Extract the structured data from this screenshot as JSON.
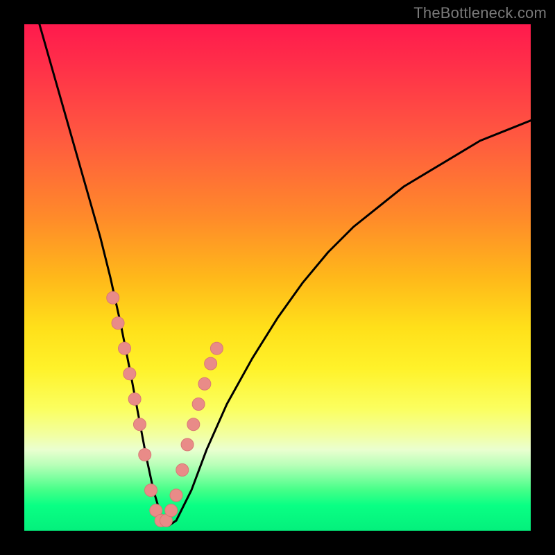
{
  "watermark": "TheBottleneck.com",
  "colors": {
    "curve": "#000000",
    "marker_fill": "#e98b88",
    "marker_stroke": "#d87975",
    "frame": "#000000"
  },
  "chart_data": {
    "type": "line",
    "title": "",
    "xlabel": "",
    "ylabel": "",
    "xlim": [
      0,
      100
    ],
    "ylim": [
      0,
      100
    ],
    "grid": false,
    "note": "Axes have no visible tick labels. Curve values are estimated from pixel positions: x is 0–100 left→right, y is 0–100 with 0 at bottom, 100 at top (bottleneck % style).",
    "series": [
      {
        "name": "bottleneck-curve",
        "x": [
          3,
          5,
          7,
          9,
          11,
          13,
          15,
          17,
          19,
          21,
          22.5,
          24,
          25.5,
          27,
          28.5,
          30,
          33,
          36,
          40,
          45,
          50,
          55,
          60,
          65,
          70,
          75,
          80,
          85,
          90,
          95,
          100
        ],
        "y": [
          100,
          93,
          86,
          79,
          72,
          65,
          58,
          50,
          41,
          31,
          23,
          15,
          8,
          3,
          1,
          2,
          8,
          16,
          25,
          34,
          42,
          49,
          55,
          60,
          64,
          68,
          71,
          74,
          77,
          79,
          81
        ]
      }
    ],
    "markers": {
      "name": "highlighted-points",
      "note": "Pink dots emphasizing the near-bottom region of the V-curve (both flanks) plus the trough.",
      "x": [
        17.5,
        18.5,
        19.8,
        20.8,
        21.8,
        22.8,
        23.8,
        25.0,
        26.0,
        27.0,
        28.0,
        29.0,
        30.0,
        31.2,
        32.2,
        33.4,
        34.4,
        35.6,
        36.8,
        38.0
      ],
      "y": [
        46.0,
        41.0,
        36.0,
        31.0,
        26.0,
        21.0,
        15.0,
        8.0,
        4.0,
        2.0,
        2.0,
        4.0,
        7.0,
        12.0,
        17.0,
        21.0,
        25.0,
        29.0,
        33.0,
        36.0
      ]
    }
  }
}
